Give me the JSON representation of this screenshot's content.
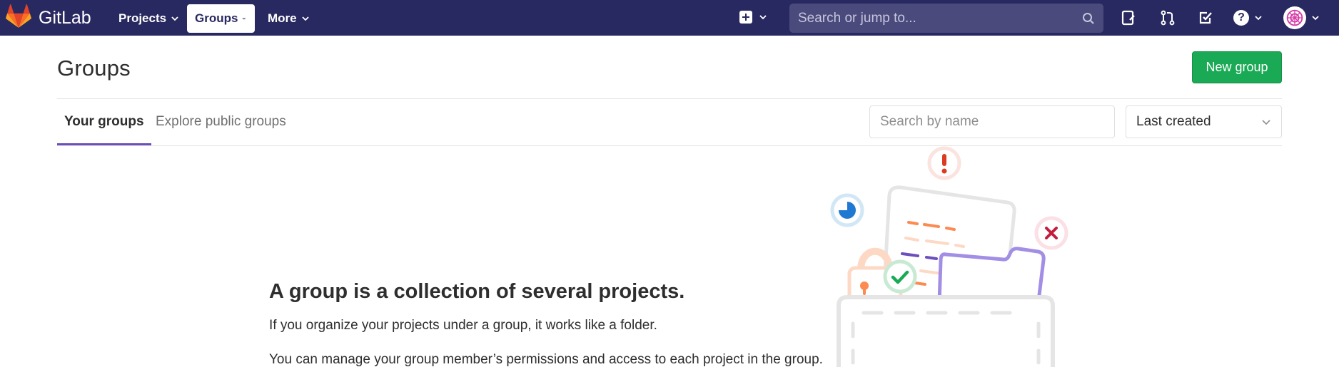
{
  "navbar": {
    "brand": "GitLab",
    "projects_label": "Projects",
    "groups_label": "Groups",
    "more_label": "More",
    "search_placeholder": "Search or jump to...",
    "colors": {
      "background": "#292961",
      "search_bg": "#4a4a7d"
    },
    "icons": [
      "gitlab-logo-icon",
      "plus-square-icon",
      "search-icon",
      "issues-icon",
      "merge-request-icon",
      "todo-icon",
      "help-icon",
      "user-avatar"
    ]
  },
  "page": {
    "title": "Groups",
    "new_group_button": "New group"
  },
  "tabs": {
    "your_groups": "Your groups",
    "explore_public": "Explore public groups",
    "active": "Your groups"
  },
  "filter": {
    "search_placeholder": "Search by name",
    "sort_selected": "Last created"
  },
  "empty_state": {
    "heading": "A group is a collection of several projects.",
    "paragraph1": "If you organize your projects under a group, it works like a folder.",
    "paragraph2": "You can manage your group member’s permissions and access to each project in the group."
  },
  "colors": {
    "accent_tab": "#6b4fbb",
    "success_button": "#1aaa55"
  }
}
